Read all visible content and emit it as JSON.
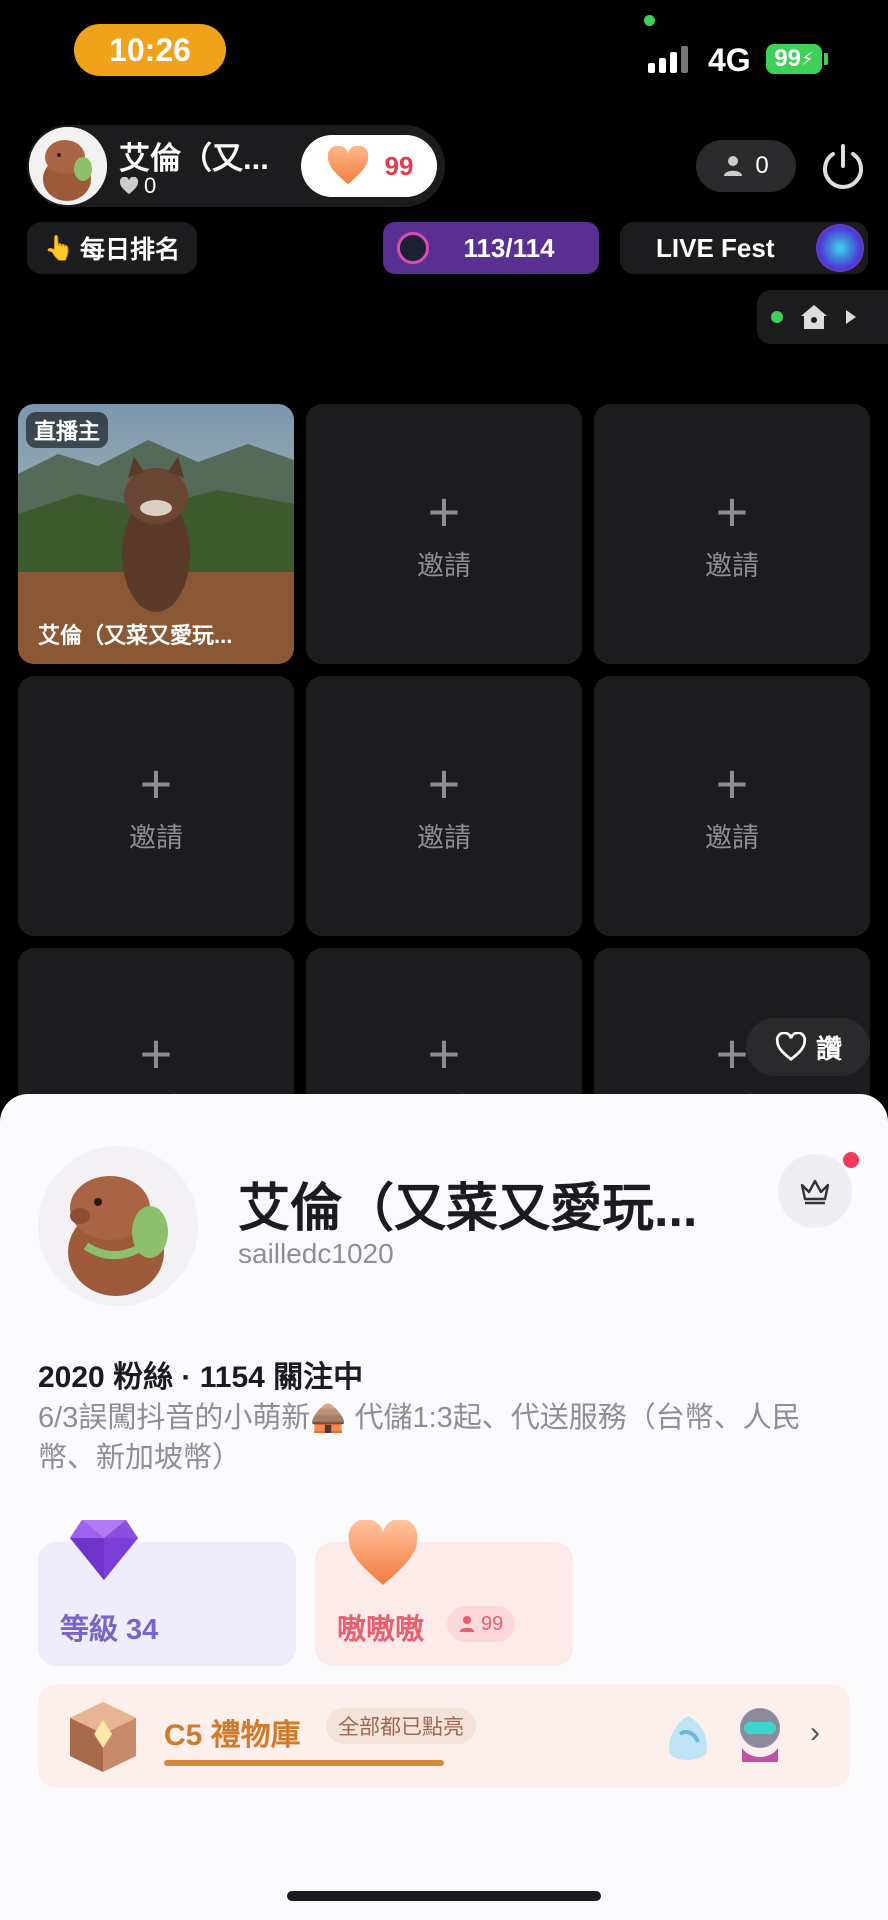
{
  "status_bar": {
    "time": "10:26",
    "network": "4G",
    "battery": "99"
  },
  "host": {
    "name": "艾倫（又...",
    "likes": "0",
    "heart_count": "99",
    "viewers": "0"
  },
  "toolbar": {
    "rank_label": "每日排名",
    "progress": "113/114",
    "fest_label": "LIVE Fest"
  },
  "grid": {
    "host_tag": "直播主",
    "host_caption": "艾倫（又菜又愛玩...",
    "plus": "+",
    "invite_label": "邀請"
  },
  "like_button": {
    "label": "讚"
  },
  "profile": {
    "name": "艾倫（又菜又愛玩...",
    "handle": "sailledc1020",
    "stats": "2020 粉絲 · 1154 關注中",
    "bio": "6/3誤闖抖音的小萌新🛖  代儲1:3起、代送服務（台幣、人民幣、新加坡幣）"
  },
  "cards": {
    "level_label": "等級 34",
    "fan_label": "嗷嗷嗷",
    "fan_count": "99"
  },
  "gift": {
    "title": "C5 禮物庫",
    "tag": "全部都已點亮"
  },
  "colors": {
    "accent_orange": "#f0a21a",
    "battery_green": "#3fd05a",
    "heart": "#f5945c",
    "fest_purple": "#5a2f92"
  },
  "icons": [
    "heart-icon",
    "fire-icon",
    "person-icon",
    "power-icon",
    "home-icon",
    "play-icon",
    "crown-icon",
    "diamond-icon",
    "chevron-right-icon"
  ]
}
